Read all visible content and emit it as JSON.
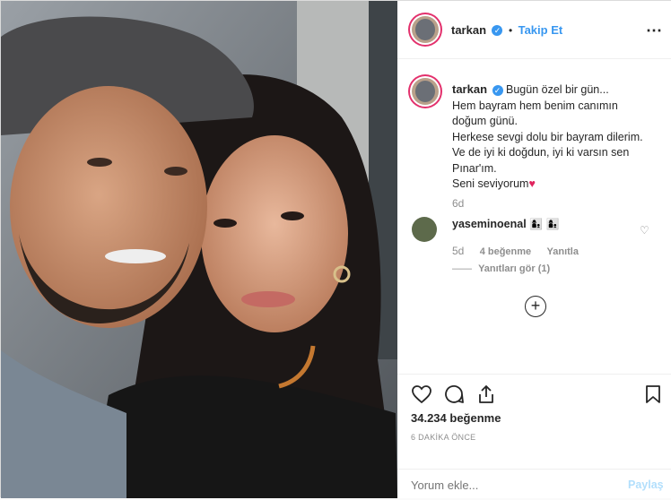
{
  "post": {
    "username": "tarkan",
    "follow_label": "Takip Et",
    "separator": "•",
    "caption_lines": [
      "Bugün özel bir gün...",
      "Hem bayram hem benim canımın",
      "doğum günü.",
      "Herkese sevgi dolu bir bayram dilerim.",
      "Ve de iyi ki doğdun, iyi ki varsın sen",
      "Pınar'ım.",
      "Seni seviyorum"
    ],
    "caption_age": "6d"
  },
  "comment": {
    "username": "yaseminoenal",
    "age": "5d",
    "likes_label": "4 beğenme",
    "reply_label": "Yanıtla",
    "view_replies_label": "Yanıtları gör (1)"
  },
  "footer": {
    "likes_label": "34.234 beğenme",
    "time_label": "6 DAKİKA ÖNCE",
    "comment_placeholder": "Yorum ekle...",
    "share_label": "Paylaş"
  },
  "colors": {
    "accent": "#3897f0",
    "muted": "#8e8e8e",
    "border": "#efefef"
  }
}
